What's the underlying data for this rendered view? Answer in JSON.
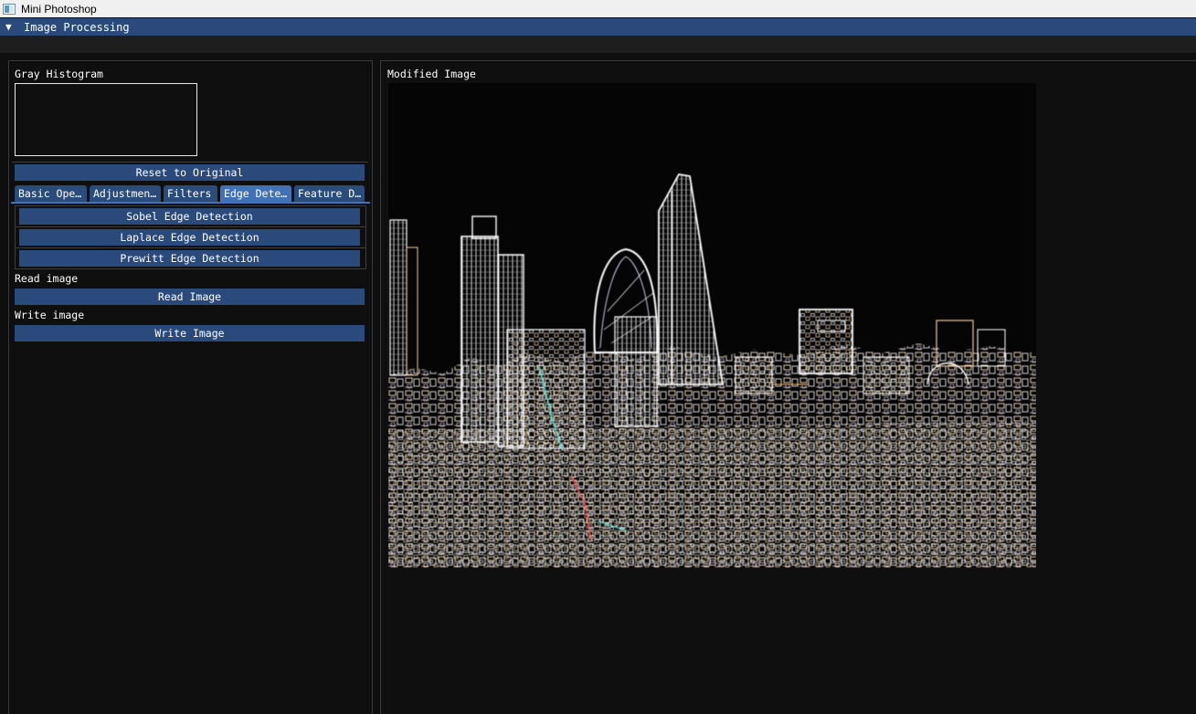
{
  "os_window": {
    "title": "Mini Photoshop",
    "icon": "app-window-icon"
  },
  "window": {
    "title": "Image Processing",
    "collapse_icon": "collapse-arrow-down-icon"
  },
  "left_panel": {
    "histogram_label": "Gray Histogram",
    "reset_button": "Reset to Original",
    "tabs": [
      {
        "label": "Basic Ope…",
        "active": false
      },
      {
        "label": "Adjustmen…",
        "active": false
      },
      {
        "label": "Filters",
        "active": false
      },
      {
        "label": "Edge Dete…",
        "active": true
      },
      {
        "label": "Feature D…",
        "active": false
      }
    ],
    "edge_buttons": [
      "Sobel Edge Detection",
      "Laplace Edge Detection",
      "Prewitt Edge Detection"
    ],
    "read_label": "Read image",
    "read_button": "Read Image",
    "write_label": "Write image",
    "write_button": "Write Image"
  },
  "right_panel": {
    "title": "Modified Image"
  },
  "colors": {
    "accent": "#294a7a",
    "active_tab": "#4272b6",
    "background": "#0f0f0f"
  }
}
